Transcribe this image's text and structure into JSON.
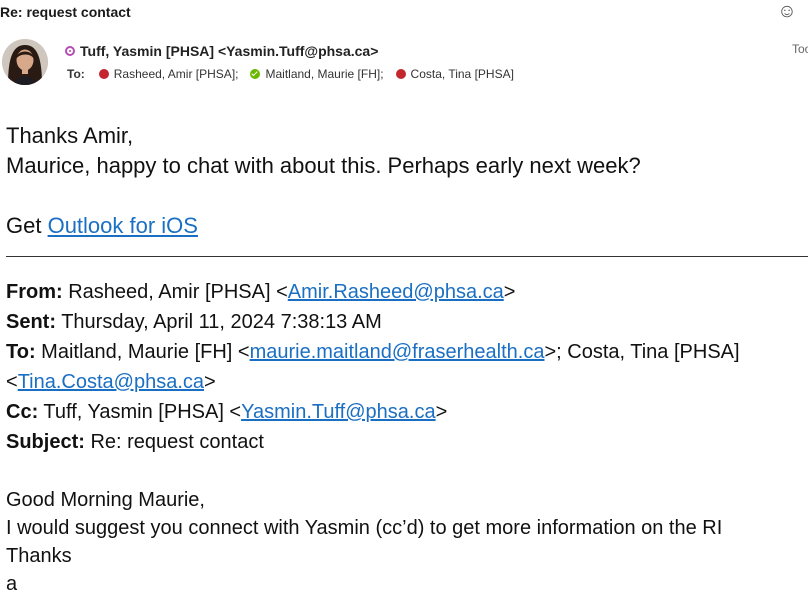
{
  "header": {
    "subject": "Re: request contact",
    "emoji_icon": "smiley-icon"
  },
  "sender": {
    "display": "Tuff, Yasmin [PHSA] <Yasmin.Tuff@phsa.ca>",
    "presence_color": "#b34fb3",
    "time": "Too"
  },
  "to_line": {
    "label": "To:",
    "recipients": [
      {
        "name": "Rasheed, Amir [PHSA];",
        "status": "busy",
        "color": "#c4262e"
      },
      {
        "name": "Maitland, Maurie [FH];",
        "status": "available",
        "color": "#6bb700"
      },
      {
        "name": "Costa, Tina [PHSA]",
        "status": "busy",
        "color": "#c4262e"
      }
    ]
  },
  "message": {
    "line1": "Thanks Amir,",
    "line2": "Maurice, happy to chat with about this. Perhaps early next week?",
    "get_prefix": "Get ",
    "outlook_link": "Outlook for iOS"
  },
  "quoted": {
    "from_label": "From:",
    "from_name": " Rasheed, Amir [PHSA] <",
    "from_email": "Amir.Rasheed@phsa.ca",
    "from_close": ">",
    "sent_label": "Sent:",
    "sent_value": " Thursday, April 11, 2024 7:38:13 AM",
    "to_label": "To:",
    "to_name1": " Maitland, Maurie [FH] <",
    "to_email1": "maurie.maitland@fraserhealth.ca",
    "to_mid": ">; Costa, Tina [PHSA]",
    "to_open2": "<",
    "to_email2": "Tina.Costa@phsa.ca",
    "to_close2": ">",
    "cc_label": "Cc:",
    "cc_name": " Tuff, Yasmin [PHSA] <",
    "cc_email": "Yasmin.Tuff@phsa.ca",
    "cc_close": ">",
    "subject_label": "Subject:",
    "subject_value": " Re: request contact",
    "greeting": "Good Morning Maurie,",
    "body": "I would suggest you connect with Yasmin (cc’d) to get more information on the RI",
    "thanks": "Thanks",
    "signoff": "a"
  },
  "colors": {
    "link": "#1a6fc3",
    "busy": "#c4262e",
    "available": "#6bb700"
  }
}
